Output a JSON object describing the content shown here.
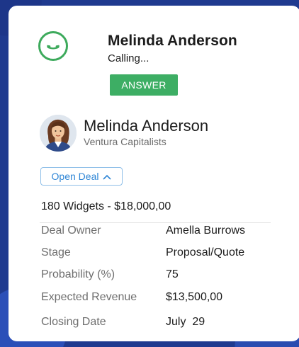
{
  "call": {
    "caller_name": "Melinda Anderson",
    "status": "Calling...",
    "answer_label": "ANSWER",
    "accent_color": "#3dae64"
  },
  "contact": {
    "name": "Melinda Anderson",
    "company": "Ventura Capitalists",
    "avatar_icon": "person-avatar"
  },
  "deal": {
    "toggle_label": "Open Deal",
    "toggle_icon": "chevron-up-icon",
    "title": "180 Widgets - $18,000,00",
    "fields": [
      {
        "label": "Deal Owner",
        "value": "Amella Burrows"
      },
      {
        "label": "Stage",
        "value": "Proposal/Quote"
      },
      {
        "label": "Probability (%)",
        "value": "75"
      },
      {
        "label": "Expected Revenue",
        "value": "$13,500,00"
      },
      {
        "label": "Closing Date",
        "value": "July  29"
      }
    ]
  }
}
